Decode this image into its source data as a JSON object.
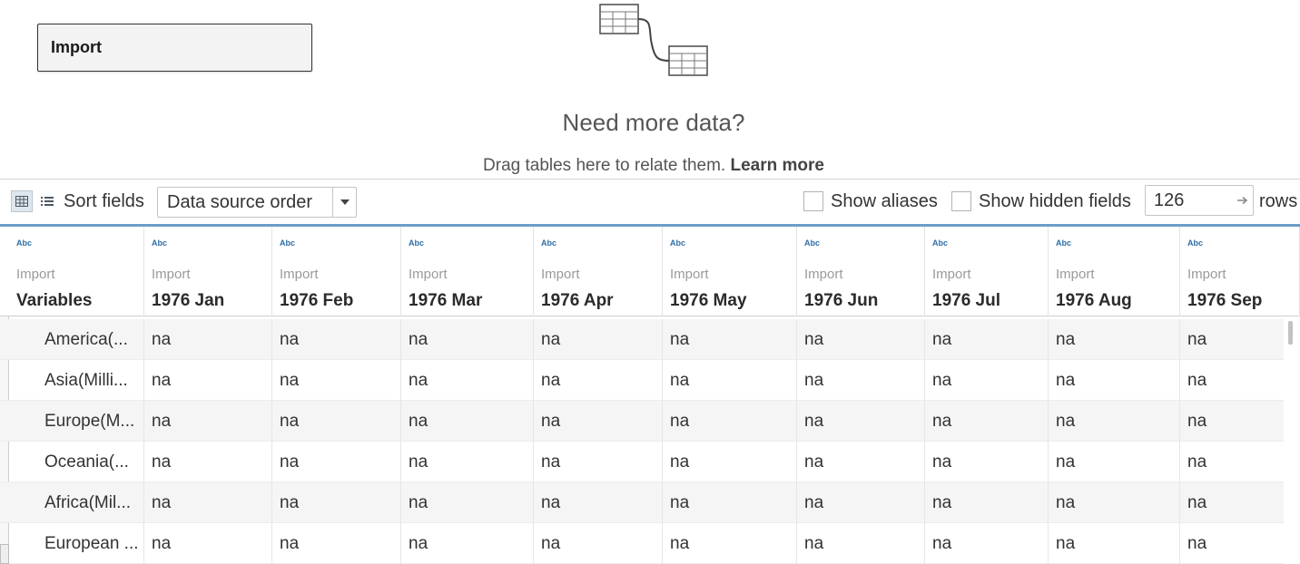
{
  "canvas": {
    "table_card": "Import",
    "prompt_title": "Need more data?",
    "prompt_hint": "Drag tables here to relate them.",
    "learn_more": "Learn more"
  },
  "toolbar": {
    "sort_label": "Sort fields",
    "sort_value": "Data source order",
    "show_aliases": "Show aliases",
    "show_hidden": "Show hidden fields",
    "rows_value": "126",
    "rows_label": "rows"
  },
  "grid": {
    "columns": [
      {
        "type": "Abc",
        "source": "Import",
        "name": "Variables"
      },
      {
        "type": "Abc",
        "source": "Import",
        "name": "1976 Jan"
      },
      {
        "type": "Abc",
        "source": "Import",
        "name": "1976 Feb"
      },
      {
        "type": "Abc",
        "source": "Import",
        "name": "1976 Mar"
      },
      {
        "type": "Abc",
        "source": "Import",
        "name": "1976 Apr"
      },
      {
        "type": "Abc",
        "source": "Import",
        "name": "1976 May"
      },
      {
        "type": "Abc",
        "source": "Import",
        "name": "1976 Jun"
      },
      {
        "type": "Abc",
        "source": "Import",
        "name": "1976 Jul"
      },
      {
        "type": "Abc",
        "source": "Import",
        "name": "1976 Aug"
      },
      {
        "type": "Abc",
        "source": "Import",
        "name": "1976 Sep"
      }
    ],
    "rows": [
      [
        "America(...",
        "na",
        "na",
        "na",
        "na",
        "na",
        "na",
        "na",
        "na",
        "na"
      ],
      [
        "Asia(Milli...",
        "na",
        "na",
        "na",
        "na",
        "na",
        "na",
        "na",
        "na",
        "na"
      ],
      [
        "Europe(M...",
        "na",
        "na",
        "na",
        "na",
        "na",
        "na",
        "na",
        "na",
        "na"
      ],
      [
        "Oceania(...",
        "na",
        "na",
        "na",
        "na",
        "na",
        "na",
        "na",
        "na",
        "na"
      ],
      [
        "Africa(Mil...",
        "na",
        "na",
        "na",
        "na",
        "na",
        "na",
        "na",
        "na",
        "na"
      ],
      [
        "European ...",
        "na",
        "na",
        "na",
        "na",
        "na",
        "na",
        "na",
        "na",
        "na"
      ]
    ]
  }
}
